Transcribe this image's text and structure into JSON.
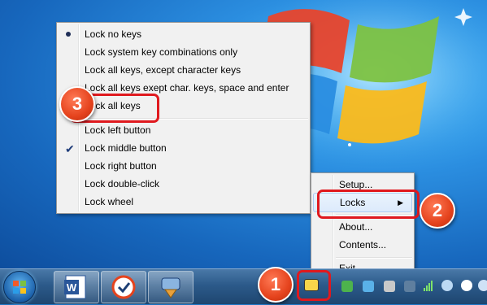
{
  "locks_submenu": {
    "items": [
      {
        "label": "Lock no keys",
        "mark": "bullet"
      },
      {
        "label": "Lock system key combinations only",
        "mark": ""
      },
      {
        "label": "Lock all keys, except character keys",
        "mark": ""
      },
      {
        "label": "Lock all keys exept char. keys, space and enter",
        "mark": ""
      },
      {
        "label": "Lock all keys",
        "mark": "",
        "annotated": true
      },
      {
        "label": "Lock left button",
        "mark": ""
      },
      {
        "label": "Lock middle button",
        "mark": "check"
      },
      {
        "label": "Lock right button",
        "mark": ""
      },
      {
        "label": "Lock double-click",
        "mark": ""
      },
      {
        "label": "Lock wheel",
        "mark": ""
      }
    ]
  },
  "tray_menu": {
    "items": [
      "Setup...",
      "Locks",
      "About...",
      "Contents...",
      "Exit"
    ],
    "locks_arrow": "▶"
  },
  "badges": {
    "one": "1",
    "two": "2",
    "three": "3"
  },
  "colors": {
    "annotation_red": "#e0191e",
    "badge_orange": "#e5431d"
  },
  "taskbar": {
    "pinned": [
      "word-app-icon",
      "clock-app-icon",
      "plug-app-icon"
    ],
    "tray_icons": [
      "keyboard-lock-tray-icon",
      "network-signal-icon",
      "volume-icon",
      "wifi-icon"
    ]
  }
}
